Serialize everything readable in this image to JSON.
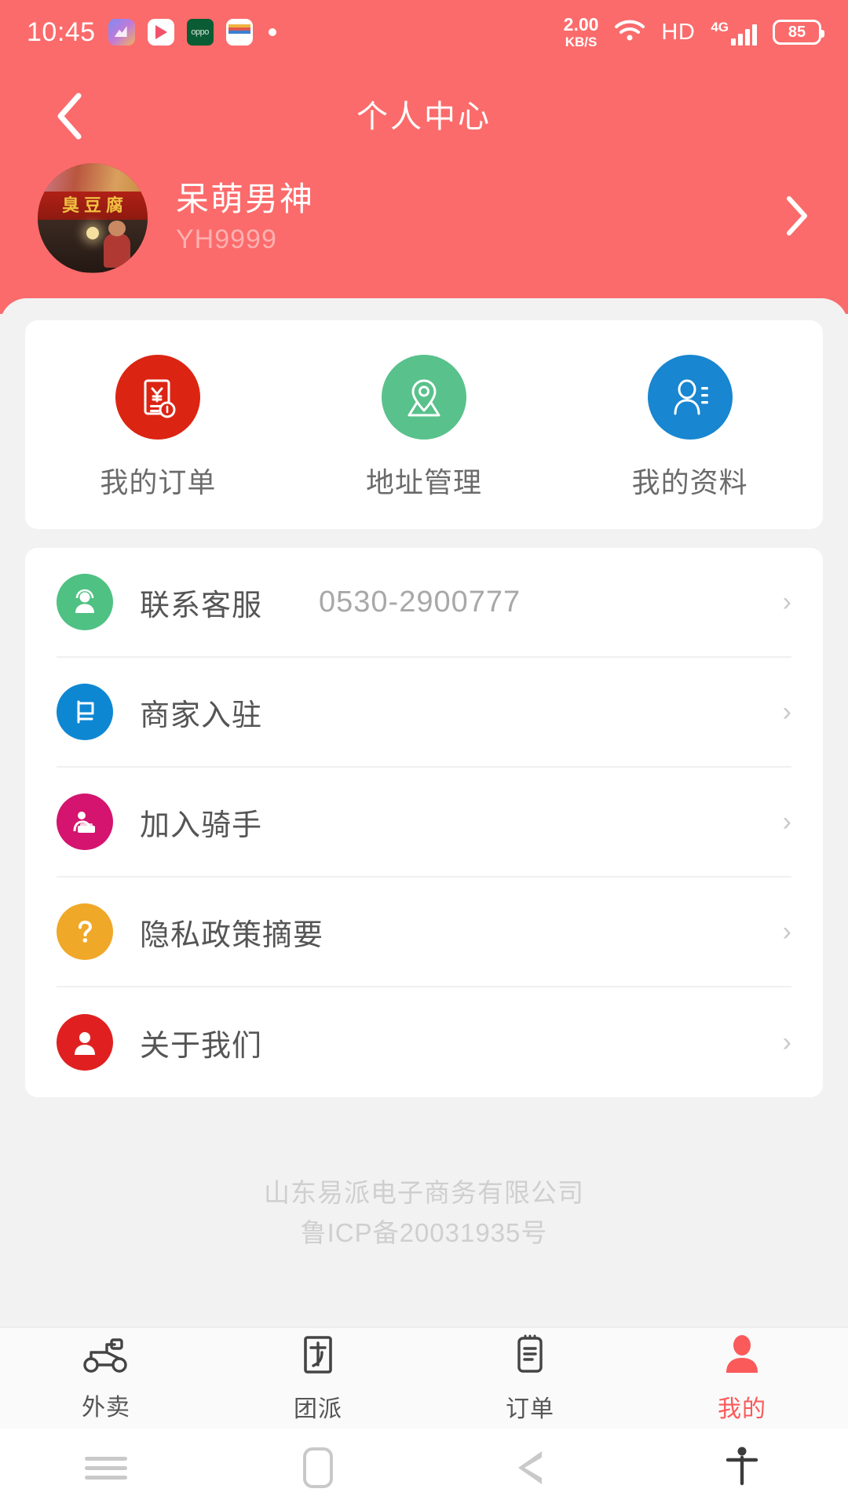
{
  "status_bar": {
    "time": "10:45",
    "app_icons": [
      "gallery-icon",
      "video-icon",
      "oppo-icon",
      "wallet-icon",
      "dot-icon"
    ],
    "network_speed_value": "2.00",
    "network_speed_unit": "KB/S",
    "wifi": "wifi-icon",
    "hd": "HD",
    "network_type": "4G",
    "battery": "85"
  },
  "header": {
    "title": "个人中心",
    "back_icon": "chevron-left-icon",
    "profile": {
      "name": "呆萌男神",
      "user_id": "YH9999",
      "chevron": "chevron-right-icon"
    },
    "bg_color": "#FB6B6B"
  },
  "quick_actions": [
    {
      "label": "我的订单",
      "icon": "order-receipt-icon",
      "color": "#DC2413"
    },
    {
      "label": "地址管理",
      "icon": "location-pin-icon",
      "color": "#59C18B"
    },
    {
      "label": "我的资料",
      "icon": "user-profile-icon",
      "color": "#1886D0"
    }
  ],
  "menu": [
    {
      "label": "联系客服",
      "value": "0530-2900777",
      "icon": "headset-support-icon",
      "color": "#4FC183"
    },
    {
      "label": "商家入驻",
      "value": "",
      "icon": "flag-shop-icon",
      "color": "#0E87D3"
    },
    {
      "label": "加入骑手",
      "value": "",
      "icon": "rider-icon",
      "color": "#D4146E"
    },
    {
      "label": "隐私政策摘要",
      "value": "",
      "icon": "question-mark-icon",
      "color": "#F0A828"
    },
    {
      "label": "关于我们",
      "value": "",
      "icon": "about-user-icon",
      "color": "#E02020"
    }
  ],
  "footer": {
    "company": "山东易派电子商务有限公司",
    "icp": "鲁ICP备20031935号"
  },
  "tab_bar": {
    "active_color": "#FB5A5A",
    "items": [
      {
        "label": "外卖",
        "icon": "scooter-icon",
        "active": false
      },
      {
        "label": "团派",
        "icon": "group-box-icon",
        "active": false
      },
      {
        "label": "订单",
        "icon": "order-list-icon",
        "active": false
      },
      {
        "label": "我的",
        "icon": "person-icon",
        "active": true
      }
    ]
  },
  "android_nav": {
    "items": [
      "recents-icon",
      "home-icon",
      "back-icon",
      "accessibility-icon"
    ]
  }
}
